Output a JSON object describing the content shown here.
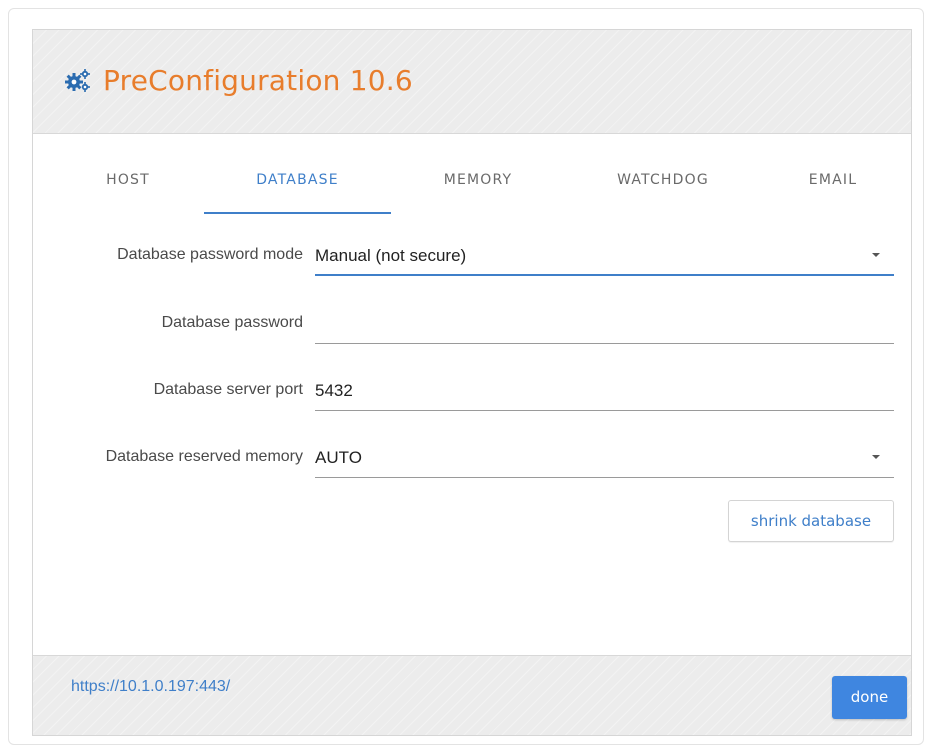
{
  "header": {
    "title": "PreConfiguration 10.6",
    "icon": "gears-icon",
    "title_color": "#e87d2c",
    "icon_color": "#2b6cb0"
  },
  "tabs": [
    {
      "label": "HOST",
      "active": false
    },
    {
      "label": "DATABASE",
      "active": true
    },
    {
      "label": "MEMORY",
      "active": false
    },
    {
      "label": "WATCHDOG",
      "active": false
    },
    {
      "label": "EMAIL",
      "active": false
    }
  ],
  "form": {
    "password_mode": {
      "label": "Database password mode",
      "value": "Manual (not secure)"
    },
    "password": {
      "label": "Database password",
      "value": ""
    },
    "server_port": {
      "label": "Database server port",
      "value": "5432"
    },
    "reserved_memory": {
      "label": "Database reserved memory",
      "value": "AUTO"
    }
  },
  "buttons": {
    "shrink": "shrink database",
    "done": "done"
  },
  "footer": {
    "url": "https://10.1.0.197:443/"
  },
  "colors": {
    "accent": "#3f7fc9",
    "primary_button": "#3f86e0"
  }
}
